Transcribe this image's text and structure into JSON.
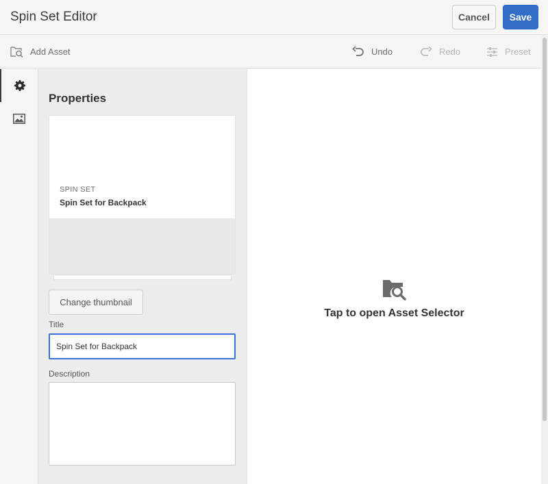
{
  "header": {
    "title": "Spin Set Editor",
    "cancel_label": "Cancel",
    "save_label": "Save",
    "save_color": "#326ec8"
  },
  "toolbar": {
    "add_asset": "Add Asset",
    "undo": "Undo",
    "redo": "Redo",
    "preset": "Preset"
  },
  "rail": {
    "items": [
      {
        "icon": "gear-icon",
        "active": true
      },
      {
        "icon": "image-icon",
        "active": false
      }
    ]
  },
  "properties": {
    "heading": "Properties",
    "card": {
      "type": "SPIN SET",
      "name": "Spin Set for Backpack"
    },
    "change_thumbnail": "Change thumbnail",
    "title_label": "Title",
    "title_value": "Spin Set for Backpack",
    "description_label": "Description",
    "description_value": ""
  },
  "canvas": {
    "asset_selector_text": "Tap to open Asset Selector"
  }
}
